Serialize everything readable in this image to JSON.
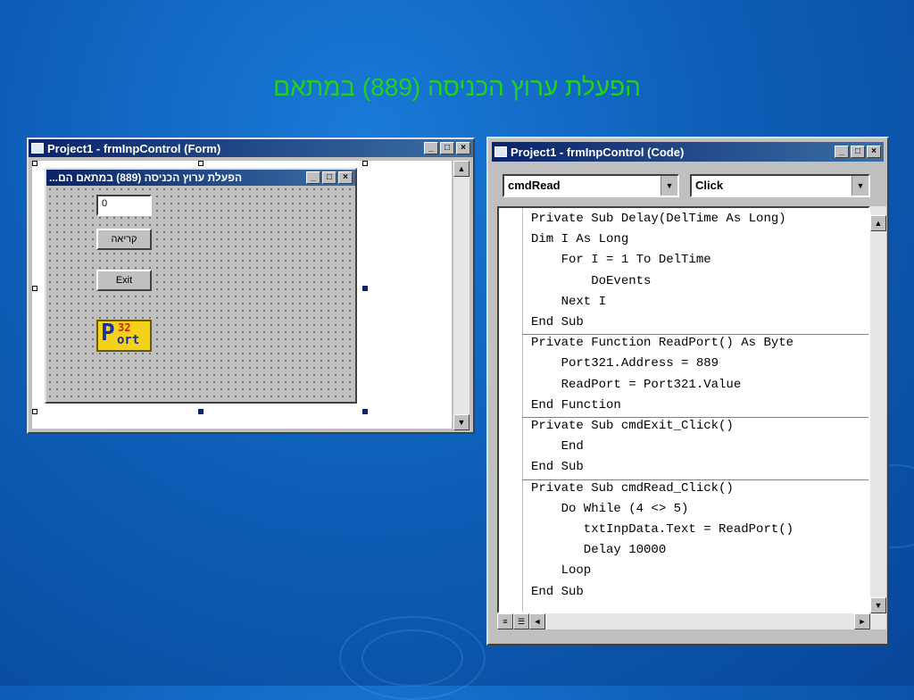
{
  "slide": {
    "title": "הפעלת ערוץ הכניסה (889) במתאם"
  },
  "form_window": {
    "title": "Project1 - frmInpControl (Form)",
    "inner_form": {
      "title": "הפעלת ערוץ הכניסה (889) במתאם הם...",
      "text_value": "0",
      "read_button": "קריאה",
      "exit_button": "Exit",
      "logo_top": "32",
      "logo_left": "P",
      "logo_bottom": "ort"
    }
  },
  "code_window": {
    "title": "Project1 - frmInpControl (Code)",
    "object_combo": "cmdRead",
    "procedure_combo": "Click",
    "code_lines": [
      "Private Sub Delay(DelTime As Long)",
      "Dim I As Long",
      "    For I = 1 To DelTime",
      "        DoEvents",
      "    Next I",
      "End Sub",
      "Private Function ReadPort() As Byte",
      "    Port321.Address = 889",
      "    ReadPort = Port321.Value",
      "End Function",
      "Private Sub cmdExit_Click()",
      "    End",
      "End Sub",
      "Private Sub cmdRead_Click()",
      "    Do While (4 <> 5)",
      "       txtInpData.Text = ReadPort()",
      "       Delay 10000",
      "    Loop",
      "End Sub"
    ]
  },
  "colors": {
    "title_green": "#22d11a",
    "titlebar_blue": "#0a246a",
    "logo_yellow": "#f3d31a"
  }
}
